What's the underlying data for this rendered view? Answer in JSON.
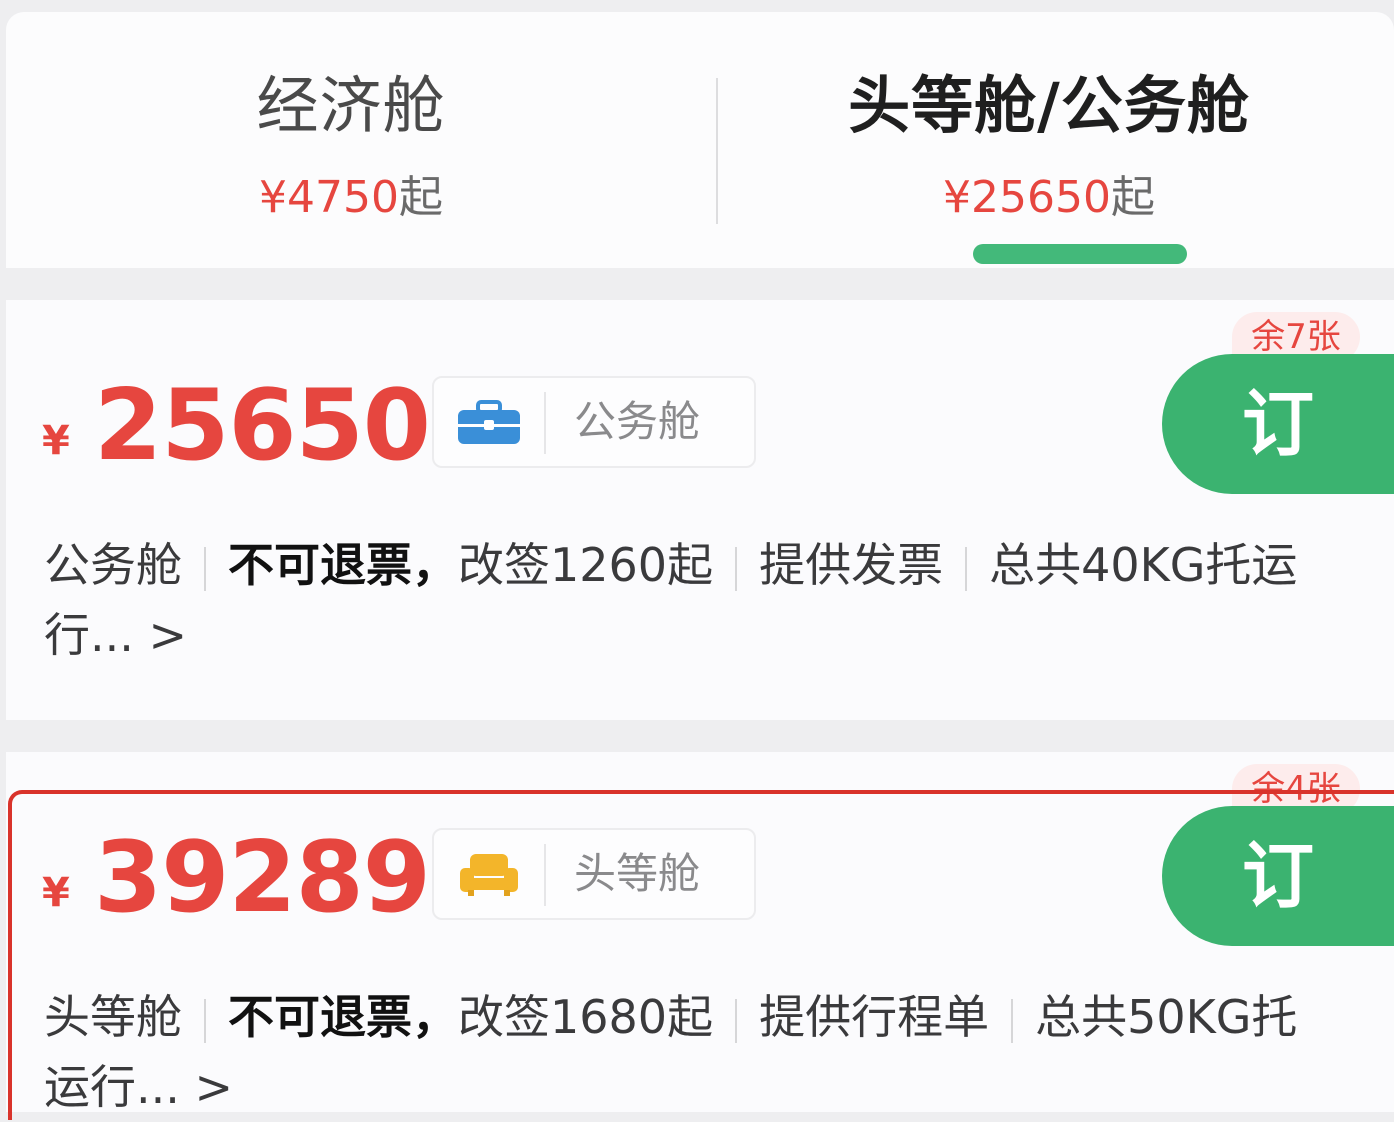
{
  "tabs": {
    "economy": {
      "title": "经济舱",
      "price": "¥4750",
      "suffix": "起"
    },
    "first_business": {
      "title": "头等舱/公务舱",
      "price": "¥25650",
      "suffix": "起"
    }
  },
  "fares": [
    {
      "remaining": "余7张",
      "yen": "¥",
      "price": "25650",
      "cabin": "公务舱",
      "icon": "briefcase-icon",
      "book": "订",
      "details": {
        "cabin": "公务舱",
        "refund": "不可退票，",
        "change": "改签1260起",
        "invoice": "提供发票",
        "baggage": "总共40KG托运",
        "more": "行... >"
      }
    },
    {
      "remaining": "余4张",
      "yen": "¥",
      "price": "39289",
      "cabin": "头等舱",
      "icon": "armchair-icon",
      "book": "订",
      "details": {
        "cabin": "头等舱",
        "refund": "不可退票，",
        "change": "改签1680起",
        "invoice": "提供行程单",
        "baggage": "总共50KG托",
        "more": "运行... >"
      }
    }
  ],
  "colors": {
    "price_red": "#e6463f",
    "accent_green": "#3bb370",
    "selected_outline": "#d9332b"
  }
}
